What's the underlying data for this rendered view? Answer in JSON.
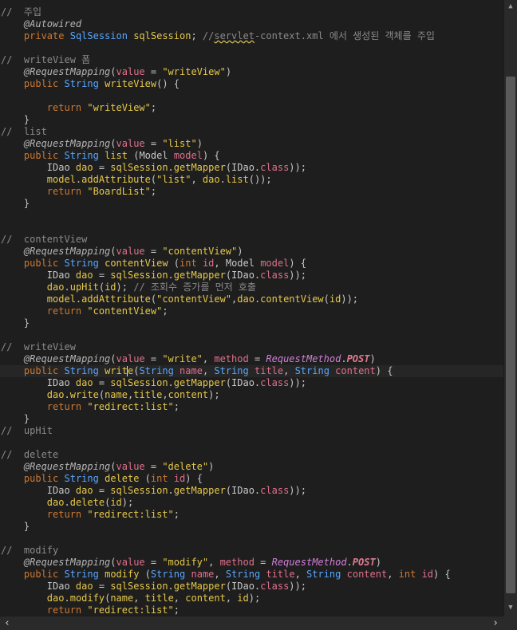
{
  "editor": {
    "current_line": 30,
    "caret_after_token": "IDao dao = sqlSession.getMapper(IDao.class);",
    "lines": [
      [
        [
          "cm",
          "//  주입"
        ]
      ],
      [
        [
          "pl",
          "    "
        ],
        [
          "an",
          "@Autowired"
        ]
      ],
      [
        [
          "pl",
          "    "
        ],
        [
          "kw",
          "private"
        ],
        [
          "pl",
          " "
        ],
        [
          "ty",
          "SqlSession"
        ],
        [
          "pl",
          " "
        ],
        [
          "id",
          "sqlSession"
        ],
        [
          "pn",
          "; "
        ],
        [
          "cm",
          "//"
        ],
        [
          "sq",
          "servlet"
        ],
        [
          "cm",
          "-context.xml 에서 생성된 객체를 주입"
        ]
      ],
      [],
      [
        [
          "cm",
          "//  writeView 폼"
        ]
      ],
      [
        [
          "pl",
          "    "
        ],
        [
          "an",
          "@RequestMapping"
        ],
        [
          "pn",
          "("
        ],
        [
          "pr",
          "value"
        ],
        [
          "pn",
          " = "
        ],
        [
          "st",
          "\"writeView\""
        ],
        [
          "pn",
          ")"
        ]
      ],
      [
        [
          "pl",
          "    "
        ],
        [
          "kw",
          "public"
        ],
        [
          "pl",
          " "
        ],
        [
          "ty",
          "String"
        ],
        [
          "pl",
          " "
        ],
        [
          "fn",
          "writeView"
        ],
        [
          "pn",
          "() {"
        ]
      ],
      [],
      [
        [
          "pl",
          "        "
        ],
        [
          "kw",
          "return"
        ],
        [
          "pl",
          " "
        ],
        [
          "st",
          "\"writeView\""
        ],
        [
          "pn",
          ";"
        ]
      ],
      [
        [
          "pl",
          "    "
        ],
        [
          "pn",
          "}"
        ]
      ],
      [
        [
          "cm",
          "//  list"
        ]
      ],
      [
        [
          "pl",
          "    "
        ],
        [
          "an",
          "@RequestMapping"
        ],
        [
          "pn",
          "("
        ],
        [
          "pr",
          "value"
        ],
        [
          "pn",
          " = "
        ],
        [
          "st",
          "\"list\""
        ],
        [
          "pn",
          ")"
        ]
      ],
      [
        [
          "pl",
          "    "
        ],
        [
          "kw",
          "public"
        ],
        [
          "pl",
          " "
        ],
        [
          "ty",
          "String"
        ],
        [
          "pl",
          " "
        ],
        [
          "fn",
          "list"
        ],
        [
          "pn",
          " ("
        ],
        [
          "pl",
          "Model "
        ],
        [
          "pr",
          "model"
        ],
        [
          "pn",
          ") {"
        ]
      ],
      [
        [
          "pl",
          "        IDao "
        ],
        [
          "id",
          "dao"
        ],
        [
          "pn",
          " = "
        ],
        [
          "id",
          "sqlSession"
        ],
        [
          "pn",
          "."
        ],
        [
          "fn",
          "getMapper"
        ],
        [
          "pn",
          "(IDao."
        ],
        [
          "cl",
          "class"
        ],
        [
          "pn",
          "));"
        ]
      ],
      [
        [
          "pl",
          "        "
        ],
        [
          "id",
          "model"
        ],
        [
          "pn",
          "."
        ],
        [
          "fn",
          "addAttribute"
        ],
        [
          "pn",
          "("
        ],
        [
          "st",
          "\"list\""
        ],
        [
          "pn",
          ", "
        ],
        [
          "id",
          "dao"
        ],
        [
          "pn",
          "."
        ],
        [
          "fn",
          "list"
        ],
        [
          "pn",
          "());"
        ]
      ],
      [
        [
          "pl",
          "        "
        ],
        [
          "kw",
          "return"
        ],
        [
          "pl",
          " "
        ],
        [
          "st",
          "\"BoardList\""
        ],
        [
          "pn",
          ";"
        ]
      ],
      [
        [
          "pl",
          "    "
        ],
        [
          "pn",
          "}"
        ]
      ],
      [],
      [],
      [
        [
          "cm",
          "//  contentView"
        ]
      ],
      [
        [
          "pl",
          "    "
        ],
        [
          "an",
          "@RequestMapping"
        ],
        [
          "pn",
          "("
        ],
        [
          "pr",
          "value"
        ],
        [
          "pn",
          " = "
        ],
        [
          "st",
          "\"contentView\""
        ],
        [
          "pn",
          ")"
        ]
      ],
      [
        [
          "pl",
          "    "
        ],
        [
          "kw",
          "public"
        ],
        [
          "pl",
          " "
        ],
        [
          "ty",
          "String"
        ],
        [
          "pl",
          " "
        ],
        [
          "fn",
          "contentView"
        ],
        [
          "pn",
          " ("
        ],
        [
          "kw",
          "int"
        ],
        [
          "pl",
          " "
        ],
        [
          "pr",
          "id"
        ],
        [
          "pn",
          ", Model "
        ],
        [
          "pr",
          "model"
        ],
        [
          "pn",
          ") {"
        ]
      ],
      [
        [
          "pl",
          "        IDao "
        ],
        [
          "id",
          "dao"
        ],
        [
          "pn",
          " = "
        ],
        [
          "id",
          "sqlSession"
        ],
        [
          "pn",
          "."
        ],
        [
          "fn",
          "getMapper"
        ],
        [
          "pn",
          "(IDao."
        ],
        [
          "cl",
          "class"
        ],
        [
          "pn",
          "));"
        ]
      ],
      [
        [
          "pl",
          "        "
        ],
        [
          "id",
          "dao"
        ],
        [
          "pn",
          "."
        ],
        [
          "fn",
          "upHit"
        ],
        [
          "pn",
          "("
        ],
        [
          "id",
          "id"
        ],
        [
          "pn",
          "); "
        ],
        [
          "cm",
          "// 조회수 증가를 먼저 호출"
        ]
      ],
      [
        [
          "pl",
          "        "
        ],
        [
          "id",
          "model"
        ],
        [
          "pn",
          "."
        ],
        [
          "fn",
          "addAttribute"
        ],
        [
          "pn",
          "("
        ],
        [
          "st",
          "\"contentView\""
        ],
        [
          "pn",
          ","
        ],
        [
          "id",
          "dao"
        ],
        [
          "pn",
          "."
        ],
        [
          "fn",
          "contentView"
        ],
        [
          "pn",
          "("
        ],
        [
          "id",
          "id"
        ],
        [
          "pn",
          "));"
        ]
      ],
      [
        [
          "pl",
          "        "
        ],
        [
          "kw",
          "return"
        ],
        [
          "pl",
          " "
        ],
        [
          "st",
          "\"contentView\""
        ],
        [
          "pn",
          ";"
        ]
      ],
      [
        [
          "pl",
          "    "
        ],
        [
          "pn",
          "}"
        ]
      ],
      [],
      [
        [
          "cm",
          "//  writeView"
        ]
      ],
      [
        [
          "pl",
          "    "
        ],
        [
          "an",
          "@RequestMapping"
        ],
        [
          "pn",
          "("
        ],
        [
          "pr",
          "value"
        ],
        [
          "pn",
          " = "
        ],
        [
          "st",
          "\"write\""
        ],
        [
          "pn",
          ", "
        ],
        [
          "pr",
          "method"
        ],
        [
          "pn",
          " = "
        ],
        [
          "en",
          "RequestMethod"
        ],
        [
          "pn",
          "."
        ],
        [
          "ec",
          "POST"
        ],
        [
          "pn",
          ")"
        ]
      ],
      [
        [
          "pl",
          "    "
        ],
        [
          "kw",
          "public"
        ],
        [
          "pl",
          " "
        ],
        [
          "ty",
          "String"
        ],
        [
          "pl",
          " "
        ],
        [
          "fn",
          "write"
        ],
        [
          "pn",
          "("
        ],
        [
          "ty",
          "String"
        ],
        [
          "pl",
          " "
        ],
        [
          "pr",
          "name"
        ],
        [
          "pn",
          ", "
        ],
        [
          "ty",
          "String"
        ],
        [
          "pl",
          " "
        ],
        [
          "pr",
          "title"
        ],
        [
          "pn",
          ", "
        ],
        [
          "ty",
          "String"
        ],
        [
          "pl",
          " "
        ],
        [
          "pr",
          "content"
        ],
        [
          "pn",
          ") {"
        ]
      ],
      [
        [
          "pl",
          "        IDao "
        ],
        [
          "id",
          "dao"
        ],
        [
          "pn",
          " = "
        ],
        [
          "id",
          "sqlSession"
        ],
        [
          "pn",
          "."
        ],
        [
          "fn",
          "getMapper"
        ],
        [
          "pn",
          "(IDao."
        ],
        [
          "cl",
          "class"
        ],
        [
          "pn",
          "));"
        ]
      ],
      [
        [
          "pl",
          "        "
        ],
        [
          "id",
          "dao"
        ],
        [
          "pn",
          "."
        ],
        [
          "fn",
          "write"
        ],
        [
          "pn",
          "("
        ],
        [
          "id",
          "name"
        ],
        [
          "pn",
          ","
        ],
        [
          "id",
          "title"
        ],
        [
          "pn",
          ","
        ],
        [
          "id",
          "content"
        ],
        [
          "pn",
          ");"
        ]
      ],
      [
        [
          "pl",
          "        "
        ],
        [
          "kw",
          "return"
        ],
        [
          "pl",
          " "
        ],
        [
          "st",
          "\"redirect:list\""
        ],
        [
          "pn",
          ";"
        ]
      ],
      [
        [
          "pl",
          "    "
        ],
        [
          "pn",
          "}"
        ]
      ],
      [
        [
          "cm",
          "//  upHit"
        ]
      ],
      [],
      [
        [
          "cm",
          "//  delete"
        ]
      ],
      [
        [
          "pl",
          "    "
        ],
        [
          "an",
          "@RequestMapping"
        ],
        [
          "pn",
          "("
        ],
        [
          "pr",
          "value"
        ],
        [
          "pn",
          " = "
        ],
        [
          "st",
          "\"delete\""
        ],
        [
          "pn",
          ")"
        ]
      ],
      [
        [
          "pl",
          "    "
        ],
        [
          "kw",
          "public"
        ],
        [
          "pl",
          " "
        ],
        [
          "ty",
          "String"
        ],
        [
          "pl",
          " "
        ],
        [
          "fn",
          "delete"
        ],
        [
          "pn",
          " ("
        ],
        [
          "kw",
          "int"
        ],
        [
          "pl",
          " "
        ],
        [
          "pr",
          "id"
        ],
        [
          "pn",
          ") {"
        ]
      ],
      [
        [
          "pl",
          "        IDao "
        ],
        [
          "id",
          "dao"
        ],
        [
          "pn",
          " = "
        ],
        [
          "id",
          "sqlSession"
        ],
        [
          "pn",
          "."
        ],
        [
          "fn",
          "getMapper"
        ],
        [
          "pn",
          "(IDao."
        ],
        [
          "cl",
          "class"
        ],
        [
          "pn",
          "));"
        ]
      ],
      [
        [
          "pl",
          "        "
        ],
        [
          "id",
          "dao"
        ],
        [
          "pn",
          "."
        ],
        [
          "fn",
          "delete"
        ],
        [
          "pn",
          "("
        ],
        [
          "id",
          "id"
        ],
        [
          "pn",
          ");"
        ]
      ],
      [
        [
          "pl",
          "        "
        ],
        [
          "kw",
          "return"
        ],
        [
          "pl",
          " "
        ],
        [
          "st",
          "\"redirect:list\""
        ],
        [
          "pn",
          ";"
        ]
      ],
      [
        [
          "pl",
          "    "
        ],
        [
          "pn",
          "}"
        ]
      ],
      [],
      [
        [
          "cm",
          "//  modify"
        ]
      ],
      [
        [
          "pl",
          "    "
        ],
        [
          "an",
          "@RequestMapping"
        ],
        [
          "pn",
          "("
        ],
        [
          "pr",
          "value"
        ],
        [
          "pn",
          " = "
        ],
        [
          "st",
          "\"modify\""
        ],
        [
          "pn",
          ", "
        ],
        [
          "pr",
          "method"
        ],
        [
          "pn",
          " = "
        ],
        [
          "en",
          "RequestMethod"
        ],
        [
          "pn",
          "."
        ],
        [
          "ec",
          "POST"
        ],
        [
          "pn",
          ")"
        ]
      ],
      [
        [
          "pl",
          "    "
        ],
        [
          "kw",
          "public"
        ],
        [
          "pl",
          " "
        ],
        [
          "ty",
          "String"
        ],
        [
          "pl",
          " "
        ],
        [
          "fn",
          "modify"
        ],
        [
          "pn",
          " ("
        ],
        [
          "ty",
          "String"
        ],
        [
          "pl",
          " "
        ],
        [
          "pr",
          "name"
        ],
        [
          "pn",
          ", "
        ],
        [
          "ty",
          "String"
        ],
        [
          "pl",
          " "
        ],
        [
          "pr",
          "title"
        ],
        [
          "pn",
          ", "
        ],
        [
          "ty",
          "String"
        ],
        [
          "pl",
          " "
        ],
        [
          "pr",
          "content"
        ],
        [
          "pn",
          ", "
        ],
        [
          "kw",
          "int"
        ],
        [
          "pl",
          " "
        ],
        [
          "pr",
          "id"
        ],
        [
          "pn",
          ") {"
        ]
      ],
      [
        [
          "pl",
          "        IDao "
        ],
        [
          "id",
          "dao"
        ],
        [
          "pn",
          " = "
        ],
        [
          "id",
          "sqlSession"
        ],
        [
          "pn",
          "."
        ],
        [
          "fn",
          "getMapper"
        ],
        [
          "pn",
          "(IDao."
        ],
        [
          "cl",
          "class"
        ],
        [
          "pn",
          "));"
        ]
      ],
      [
        [
          "pl",
          "        "
        ],
        [
          "id",
          "dao"
        ],
        [
          "pn",
          "."
        ],
        [
          "fn",
          "modify"
        ],
        [
          "pn",
          "("
        ],
        [
          "id",
          "name"
        ],
        [
          "pn",
          ", "
        ],
        [
          "id",
          "title"
        ],
        [
          "pn",
          ", "
        ],
        [
          "id",
          "content"
        ],
        [
          "pn",
          ", "
        ],
        [
          "id",
          "id"
        ],
        [
          "pn",
          ");"
        ]
      ],
      [
        [
          "pl",
          "        "
        ],
        [
          "kw",
          "return"
        ],
        [
          "pl",
          " "
        ],
        [
          "st",
          "\"redirect:list\""
        ],
        [
          "pn",
          ";"
        ]
      ],
      [
        [
          "pl",
          "    "
        ],
        [
          "pn",
          "}"
        ]
      ]
    ]
  },
  "scrollbars": {
    "vertical_up_icon": "▲",
    "vertical_down_icon": "▼",
    "horizontal_left_icon": "‹",
    "horizontal_right_icon": "›"
  },
  "colors": {
    "background": "#1e1e1e",
    "comment": "#8b8b8b",
    "keyword": "#cc7832",
    "type": "#58a6ff",
    "string": "#e6c84a",
    "parameter": "#e0708c"
  }
}
